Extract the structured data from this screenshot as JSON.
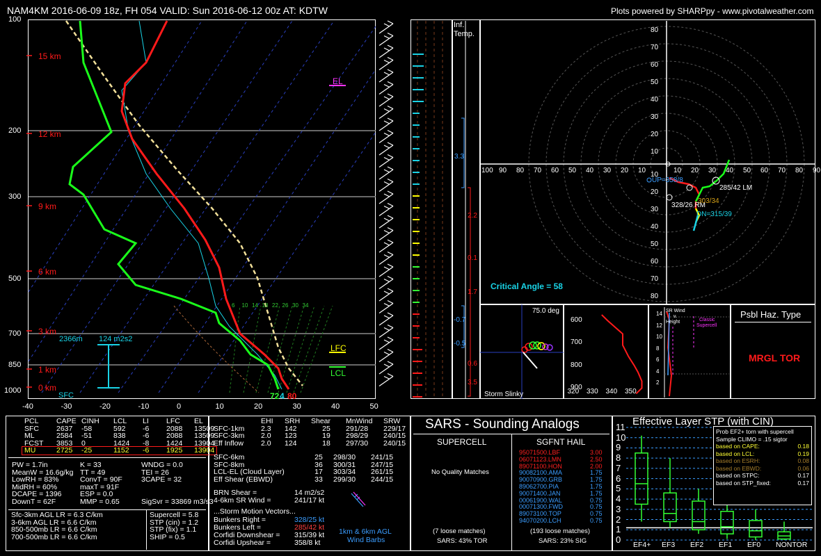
{
  "header": {
    "title": "NAM4KM 2016-06-09 18z, FH 054   VALID: Sun 2016-06-12 00z   AT: KDTW",
    "credit": "Plots powered by SHARPpy - www.pivotalweather.com"
  },
  "skewt": {
    "pressure_ticks": [
      "100",
      "200",
      "300",
      "500",
      "700",
      "850",
      "1000"
    ],
    "height_labels": [
      "15 km",
      "12 km",
      "9 km",
      "6 km",
      "3 km",
      "1 km",
      "0 km"
    ],
    "temp_ticks": [
      "-40",
      "-30",
      "-20",
      "-10",
      "0",
      "10",
      "20",
      "30",
      "40",
      "50"
    ],
    "el_label": "EL",
    "lfc_label": "LFC",
    "lcl_label": "LCL",
    "sfc_label": "SFC",
    "eff_inflow_depth": "2366m",
    "eff_inflow_srh": "124 m2s2",
    "sfc_dewpoint": "72",
    "sfc_wetbulb": "4",
    "sfc_temp": "80",
    "mixing_ratio_labels": [
      "6",
      "10",
      "14",
      "18",
      "22",
      "26",
      "30",
      "34"
    ]
  },
  "inflow": {
    "title_line1": "Inf.",
    "title_line2": "Temp.",
    "values": [
      "3.3",
      "2.2",
      "0.1",
      "1.7",
      "-0.7",
      "-0.5",
      "0.6",
      "3.5"
    ]
  },
  "hodograph": {
    "ring_labels": [
      "80",
      "70",
      "60",
      "50",
      "40",
      "30",
      "20",
      "10"
    ],
    "x_ticks": [
      "100",
      "90",
      "80",
      "70",
      "60",
      "50",
      "40",
      "30",
      "20",
      "10",
      "10",
      "20",
      "30",
      "40",
      "50",
      "60",
      "70",
      "80",
      "90",
      "100"
    ],
    "lm_label": "285/42 LM",
    "rm_label": "328/26 RM",
    "up_label": "UP=358/8",
    "dn_label": "DN=315/39",
    "mean_label": "303/34",
    "critical_angle": "Critical Angle = 58"
  },
  "slinky": {
    "angle": "75.0 deg",
    "title": "Storm Slinky"
  },
  "theta": {
    "y_ticks": [
      "600",
      "700",
      "800",
      "900"
    ],
    "x_ticks": [
      "320",
      "330",
      "340",
      "350"
    ],
    "chart_data": {
      "type": "line",
      "title": "",
      "xlabel": "",
      "ylabel": "",
      "xlim": [
        318,
        358
      ],
      "ylim": [
        930,
        560
      ],
      "series": [
        {
          "name": "",
          "x": [
            335,
            338,
            342,
            346,
            346,
            349,
            352,
            354,
            356,
            356,
            353
          ],
          "y": [
            575,
            600,
            630,
            660,
            710,
            760,
            800,
            830,
            870,
            900,
            925
          ]
        }
      ]
    }
  },
  "srwind": {
    "y_ticks": [
      "14",
      "12",
      "10",
      "8",
      "6",
      "4",
      "2"
    ],
    "title_line1": "SR Wind",
    "title_line2": "v.",
    "title_line3": "Height",
    "classic_line1": "Classic",
    "classic_line2": "Supercell"
  },
  "hazard": {
    "title": "Psbl Haz. Type",
    "value": "MRGL TOR"
  },
  "parcels": {
    "headers": [
      "PCL",
      "CAPE",
      "CINH",
      "LCL",
      "LI",
      "LFC",
      "EL"
    ],
    "rows": [
      [
        "SFC",
        "2637",
        "-58",
        "592",
        "-6",
        "2088",
        "13509"
      ],
      [
        "ML",
        "2584",
        "-51",
        "838",
        "-6",
        "2088",
        "13509"
      ],
      [
        "FCST",
        "3853",
        "0",
        "1424",
        "-8",
        "1424",
        "13904"
      ],
      [
        "MU",
        "2725",
        "-25",
        "1152",
        "-6",
        "1925",
        "13904"
      ]
    ]
  },
  "thermo": [
    [
      "PW = 1.7in",
      "K = 33",
      "WNDG = 0.0"
    ],
    [
      "MeanW = 16.6g/kg",
      "TT = 49",
      "TEI = 26"
    ],
    [
      "LowRH = 83%",
      "ConvT = 90F",
      "3CAPE = 32"
    ],
    [
      "MidRH = 60%",
      "maxT = 91F",
      ""
    ],
    [
      "DCAPE = 1396",
      "ESP = 0.0",
      ""
    ],
    [
      "DownT = 62F",
      "MMP = 0.65",
      "SigSvr = 33869 m3/s3"
    ]
  ],
  "lapse": [
    "Sfc-3km AGL LR = 6.3 C/km",
    "3-6km AGL LR = 6.6 C/km",
    "850-500mb LR = 6.6 C/km",
    "700-500mb LR = 6.6 C/km"
  ],
  "composite": [
    "Supercell = 5.8",
    "STP (cin) = 1.2",
    "STP (fix) = 1.1",
    "SHIP = 0.5"
  ],
  "kinematics": {
    "headers": [
      "",
      "EHI",
      "SRH",
      "Shear",
      "MnWind",
      "SRW"
    ],
    "rows1": [
      [
        "SFC-1km",
        "2.3",
        "142",
        "25",
        "291/28",
        "229/17"
      ],
      [
        "SFC-3km",
        "2.0",
        "123",
        "19",
        "298/29",
        "240/15"
      ],
      [
        "Eff Inflow",
        "2.0",
        "124",
        "18",
        "297/30",
        "240/15"
      ]
    ],
    "rows2": [
      [
        "SFC-6km",
        "",
        "",
        "25",
        "298/30",
        "241/15"
      ],
      [
        "SFC-8km",
        "",
        "",
        "36",
        "300/31",
        "247/15"
      ],
      [
        "LCL-EL (Cloud Layer)",
        "",
        "",
        "17",
        "303/34",
        "261/15"
      ],
      [
        "Eff Shear (EBWD)",
        "",
        "",
        "33",
        "299/30",
        "244/15"
      ]
    ],
    "brn_label": "BRN Shear =",
    "brn_value": "14 m2/s2",
    "srwind_label": "4-6km SR Wind =",
    "srwind_value": "241/17 kt",
    "motion_title": "...Storm Motion Vectors...",
    "motion": [
      {
        "label": "Bunkers Right =",
        "value": "328/25 kt",
        "color": "#3b9dff"
      },
      {
        "label": "Bunkers Left =",
        "value": "285/42 kt",
        "color": "#ff4040"
      },
      {
        "label": "Corfidi Downshear =",
        "value": "315/39 kt",
        "color": "#ffffff"
      },
      {
        "label": "Corfidi Upshear =",
        "value": "358/8 kt",
        "color": "#ffffff"
      }
    ],
    "barb_caption_line1": "1km & 6km AGL",
    "barb_caption_line2": "Wind Barbs"
  },
  "sars": {
    "title": "SARS - Sounding Analogs",
    "supercell_title": "SUPERCELL",
    "supercell_body": "No Quality Matches",
    "supercell_loose": "(7 loose matches)",
    "supercell_pct": "SARS: 43% TOR",
    "hail_title": "SGFNT HAIL",
    "hail_rows": [
      {
        "id": "95071500.LBF",
        "val": "3.00",
        "color": "#ff2020"
      },
      {
        "id": "06071123.LMN",
        "val": "2.50",
        "color": "#ff2020"
      },
      {
        "id": "89071100.HON",
        "val": "2.00",
        "color": "#ff2020"
      },
      {
        "id": "90082100.AMA",
        "val": "1.75",
        "color": "#3b9dff"
      },
      {
        "id": "90070900.GRB",
        "val": "1.75",
        "color": "#3b9dff"
      },
      {
        "id": "89062700.PIA",
        "val": "1.75",
        "color": "#3b9dff"
      },
      {
        "id": "90071400.JAN",
        "val": "1.75",
        "color": "#3b9dff"
      },
      {
        "id": "00061900.WAL",
        "val": "0.75",
        "color": "#3b9dff"
      },
      {
        "id": "00071300.FWD",
        "val": "0.75",
        "color": "#3b9dff"
      },
      {
        "id": "89073100.TOP",
        "val": "0.75",
        "color": "#3b9dff"
      },
      {
        "id": "94070200.LCH",
        "val": "0.75",
        "color": "#3b9dff"
      }
    ],
    "hail_loose": "(193 loose matches)",
    "hail_pct": "SARS: 23% SIG"
  },
  "stp": {
    "title": "Effective Layer STP (with CIN)",
    "legend_title1": "Prob EF2+ torn with supercell",
    "legend_title2": "Sample CLIMO = .15 sigtor",
    "legend": [
      {
        "label": "based on CAPE:",
        "value": "0.18",
        "color": "#ffff33"
      },
      {
        "label": "based on LCL:",
        "value": "0.19",
        "color": "#ffff33"
      },
      {
        "label": "based on ESRH:",
        "value": "0.08",
        "color": "#a57d2a"
      },
      {
        "label": "based on EBWD:",
        "value": "0.06",
        "color": "#a57d2a"
      },
      {
        "label": "based on STPC:",
        "value": "0.17",
        "color": "#ffffff"
      },
      {
        "label": "based on STP_fixed:",
        "value": "0.17",
        "color": "#ffffff"
      }
    ],
    "chart_data": {
      "type": "box",
      "categories": [
        "EF4+",
        "EF3",
        "EF2",
        "EF1",
        "EF0",
        "NONTOR"
      ],
      "ylim": [
        0,
        11
      ],
      "yticks": [
        "0",
        "1",
        "2",
        "3",
        "4",
        "5",
        "6",
        "7",
        "8",
        "9",
        "10",
        "11"
      ],
      "boxes": [
        {
          "whislo": 1.8,
          "q1": 3.5,
          "med": 5.5,
          "q3": 8.5,
          "whishi": 10.2
        },
        {
          "whislo": 1.2,
          "q1": 1.8,
          "med": 2.6,
          "q3": 4.6,
          "whishi": 8.0
        },
        {
          "whislo": 0.6,
          "q1": 1.0,
          "med": 1.8,
          "q3": 3.8,
          "whishi": 5.0
        },
        {
          "whislo": 0.1,
          "q1": 0.6,
          "med": 1.3,
          "q3": 2.8,
          "whishi": 4.6
        },
        {
          "whislo": 0.0,
          "q1": 0.3,
          "med": 0.9,
          "q3": 1.9,
          "whishi": 3.0
        },
        {
          "whislo": 0.0,
          "q1": 0.1,
          "med": 0.4,
          "q3": 0.8,
          "whishi": 1.8
        }
      ],
      "value_line": 1.2
    }
  },
  "colors": {
    "temp": "#ff1a1a",
    "dewpoint": "#1aff1a",
    "parcel": "#f2e09a",
    "cyan": "#19d3e6",
    "green": "#33ff33",
    "yellow": "#ffff00",
    "magenta": "#ff33ff",
    "blue": "#3b9dff"
  }
}
